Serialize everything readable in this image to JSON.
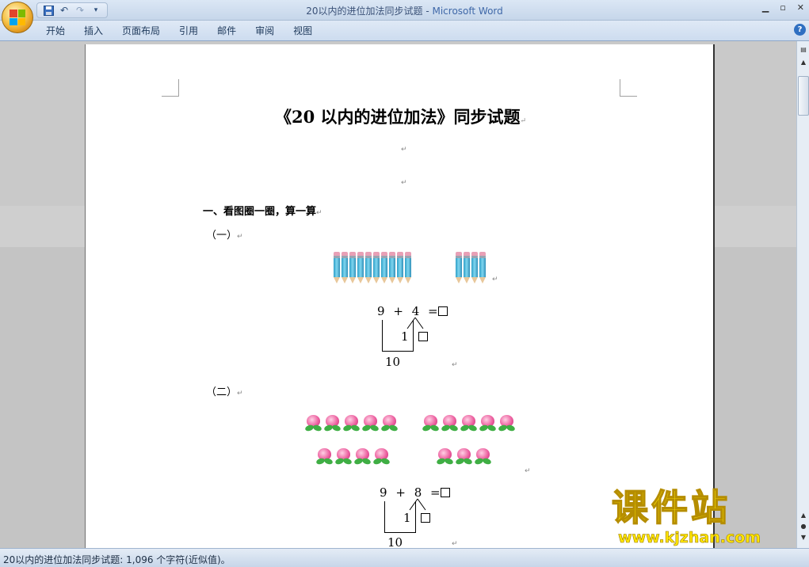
{
  "window": {
    "title": "20以内的进位加法同步试题",
    "separator": " - ",
    "app_name": "Microsoft Word"
  },
  "quick_access": {
    "save_icon": "save-icon",
    "undo_icon": "undo-icon",
    "redo_icon": "redo-icon",
    "customize_icon": "customize-qat-icon"
  },
  "ribbon": {
    "tabs": [
      "开始",
      "插入",
      "页面布局",
      "引用",
      "邮件",
      "审阅",
      "视图"
    ],
    "help_label": "?"
  },
  "document": {
    "title": "《20 以内的进位加法》同步试题",
    "paragraph_mark": "↵",
    "section1": "一、看图圈一圈，算一算",
    "part1_label": "（一）",
    "part2_label": "（二）",
    "part1": {
      "pencils_group_a": 10,
      "pencils_group_b": 4,
      "equation": {
        "a": "9",
        "op": "+",
        "b": "4",
        "eq": "=",
        "split_part": "1",
        "ten": "10"
      }
    },
    "part2": {
      "peaches_row1_group_a": 5,
      "peaches_row1_group_b": 5,
      "peaches_row2_group_a": 4,
      "peaches_row2_group_b": 3,
      "equation": {
        "a": "9",
        "op": "+",
        "b": "8",
        "eq": "=",
        "split_part": "1",
        "ten": "10"
      }
    }
  },
  "status_bar": {
    "text": "20以内的进位加法同步试题: 1,096 个字符(近似值)。"
  },
  "watermark": {
    "title": "课件站",
    "url": "www.kjzhan.com"
  },
  "colors": {
    "accent": "#3f68a8",
    "watermark": "#ffe600"
  }
}
